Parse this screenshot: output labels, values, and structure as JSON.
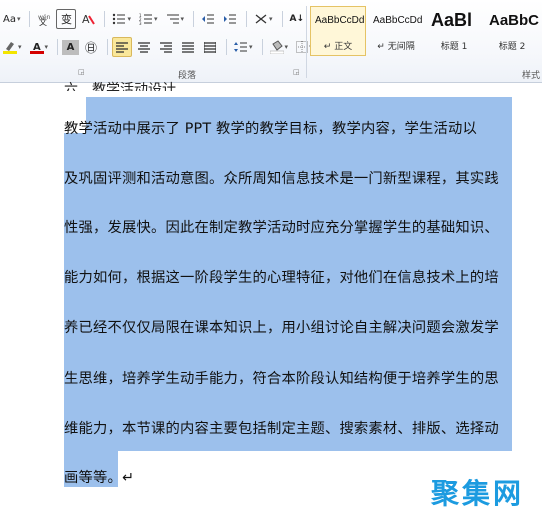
{
  "ribbon": {
    "font": {
      "change_case": "Aa",
      "pinyin": "ab",
      "char_border": "变",
      "text_highlight_label": "aby",
      "font_color_label": "A",
      "char_shading": "A",
      "enclose_char": "㊐"
    },
    "paragraph": {
      "label": "段落",
      "sort": "A↓"
    },
    "styles_label": "样式",
    "styles": [
      {
        "sample": "AaBbCcDd",
        "name": "↵ 正文",
        "selected": true
      },
      {
        "sample": "AaBbCcDd",
        "name": "↵ 无间隔",
        "selected": false
      },
      {
        "sample": "AaBl",
        "name": "标题 1",
        "selected": false
      },
      {
        "sample": "AaBbC",
        "name": "标题 2",
        "selected": false
      }
    ],
    "colors": {
      "highlight": "#f3e500",
      "font_color": "#d40000",
      "selection": "#9cc0ec"
    }
  },
  "document": {
    "previous_line": "六、教学活动设计",
    "lines": [
      "    教学活动中展示了 PPT 教学的教学目标，教学内容，学生活动以",
      "及巩固评测和活动意图。众所周知信息技术是一门新型课程，其实践",
      "性强，发展快。因此在制定教学活动时应充分掌握学生的基础知识、",
      "能力如何，根据这一阶段学生的心理特征，对他们在信息技术上的培",
      "养已经不仅仅局限在课本知识上，用小组讨论自主解决问题会激发学",
      "生思维，培养学生动手能力，符合本阶段认知结构便于培养学生的思",
      "维能力，本节课的内容主要包括制定主题、搜索素材、排版、选择动",
      "画等等。↵"
    ]
  },
  "watermark": "聚集网"
}
